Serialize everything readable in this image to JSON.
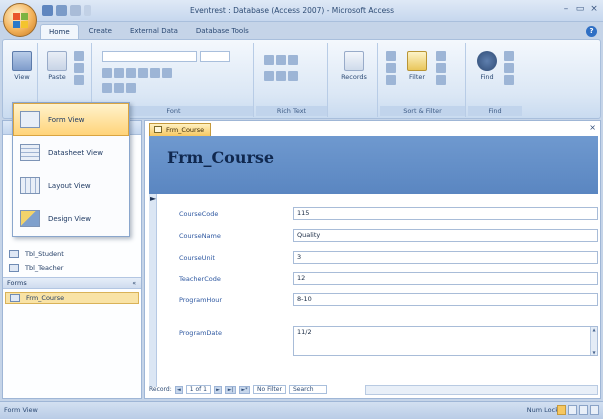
{
  "window": {
    "title": "Eventrest : Database (Access 2007) - Microsoft Access",
    "controls": [
      "–",
      "▭",
      "×"
    ]
  },
  "ribbon": {
    "tabs": [
      {
        "label": "Home",
        "active": true
      },
      {
        "label": "Create",
        "active": false
      },
      {
        "label": "External Data",
        "active": false
      },
      {
        "label": "Database Tools",
        "active": false
      }
    ],
    "groups": {
      "views_button": "View",
      "paste_button": "Paste",
      "font_label": "Font",
      "rich_text_label": "Rich Text",
      "records_button": "Records",
      "sort_filter_label": "Sort & Filter",
      "filter_button": "Filter",
      "find_button": "Find",
      "find_label": "Find"
    }
  },
  "view_menu": {
    "items": [
      {
        "label": "Form View",
        "selected": true
      },
      {
        "label": "Datasheet View",
        "selected": false
      },
      {
        "label": "Layout View",
        "selected": false
      },
      {
        "label": "Design View",
        "selected": false
      }
    ]
  },
  "nav_pane": {
    "items_above": [
      {
        "label": "Tbl_Student"
      },
      {
        "label": "Tbl_Teacher"
      }
    ],
    "group": {
      "label": "Forms",
      "chevron": "«"
    },
    "forms": [
      {
        "label": "Frm_Course",
        "selected": true
      }
    ]
  },
  "document": {
    "tab_label": "Frm_Course",
    "close_glyph": "×",
    "form_title": "Frm_Course",
    "fields": [
      {
        "label": "CourseCode",
        "value": "115"
      },
      {
        "label": "CourseName",
        "value": "Quality"
      },
      {
        "label": "CourseUnit",
        "value": "3"
      },
      {
        "label": "TeacherCode",
        "value": "12"
      },
      {
        "label": "ProgramHour",
        "value": "8-10"
      },
      {
        "label": "ProgramDate",
        "value": "11/2"
      }
    ],
    "record_nav": {
      "record_label": "Record:",
      "first": "◄",
      "position": "1 of 1",
      "next": "►",
      "last": "►|",
      "new": "►*",
      "filter_state": "No Filter",
      "search": "Search"
    }
  },
  "status_bar": {
    "left": "Form View",
    "right": "Num Lock"
  },
  "colors": {
    "form_header": "#5a86c1",
    "accent_selected": "#ffd47a",
    "label_text": "#2d57a0"
  }
}
